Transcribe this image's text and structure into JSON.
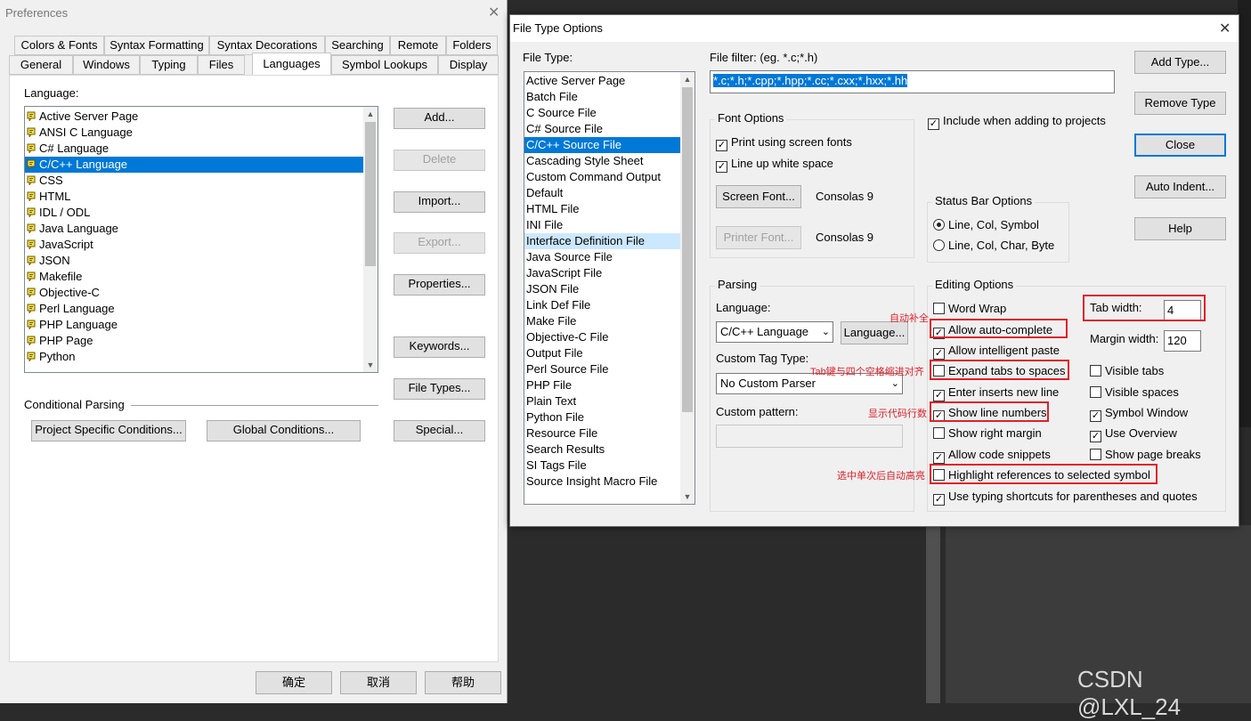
{
  "preferences": {
    "title": "Preferences",
    "tabs_row1": [
      "Colors & Fonts",
      "Syntax Formatting",
      "Syntax Decorations",
      "Searching",
      "Remote",
      "Folders"
    ],
    "tabs_row2": [
      "General",
      "Windows",
      "Typing",
      "Files",
      "Languages",
      "Symbol Lookups",
      "Display"
    ],
    "language_label": "Language:",
    "languages": [
      "Active Server Page",
      "ANSI C Language",
      "C# Language",
      "C/C++ Language",
      "CSS",
      "HTML",
      "IDL / ODL",
      "Java Language",
      "JavaScript",
      "JSON",
      "Makefile",
      "Objective-C",
      "Perl Language",
      "PHP Language",
      "PHP Page",
      "Python"
    ],
    "buttons": {
      "add": "Add...",
      "delete": "Delete",
      "import": "Import...",
      "export": "Export...",
      "properties": "Properties...",
      "keywords": "Keywords...",
      "file_types": "File Types...",
      "special": "Special..."
    },
    "conditional_label": "Conditional Parsing",
    "project_conditions": "Project Specific Conditions...",
    "global_conditions": "Global Conditions...",
    "ok": "确定",
    "cancel": "取消",
    "help": "帮助"
  },
  "file_type_options": {
    "title": "File Type Options",
    "file_type_label": "File Type:",
    "file_types": [
      "Active Server Page",
      "Batch File",
      "C Source File",
      "C# Source File",
      "C/C++ Source File",
      "Cascading Style Sheet",
      "Custom Command Output",
      "Default",
      "HTML File",
      "INI File",
      "Interface Definition File",
      "Java Source File",
      "JavaScript File",
      "JSON File",
      "Link Def File",
      "Make File",
      "Objective-C File",
      "Output File",
      "Perl Source File",
      "PHP File",
      "Plain Text",
      "Python File",
      "Resource File",
      "Search Results",
      "SI Tags File",
      "Source Insight Macro File"
    ],
    "file_filter_label": "File filter: (eg. *.c;*.h)",
    "file_filter_value": "*.c;*.h;*.cpp;*.hpp;*.cc;*.cxx;*.hxx;*.hh",
    "font_options": {
      "label": "Font Options",
      "print_screen_fonts": "Print using screen fonts",
      "line_up_white_space": "Line up white space",
      "screen_font_btn": "Screen Font...",
      "screen_font_value": "Consolas 9",
      "printer_font_btn": "Printer Font...",
      "printer_font_value": "Consolas 9"
    },
    "include_projects": "Include when adding to projects",
    "status_bar": {
      "label": "Status Bar Options",
      "opt1": "Line, Col, Symbol",
      "opt2": "Line, Col, Char, Byte"
    },
    "parsing": {
      "label": "Parsing",
      "language_label": "Language:",
      "language_value": "C/C++ Language",
      "language_btn": "Language...",
      "custom_tag_label": "Custom Tag Type:",
      "custom_tag_value": "No Custom Parser",
      "custom_pattern_label": "Custom pattern:"
    },
    "editing": {
      "label": "Editing Options",
      "word_wrap": "Word Wrap",
      "auto_complete": "Allow auto-complete",
      "intelligent_paste": "Allow intelligent paste",
      "expand_tabs": "Expand tabs to spaces",
      "enter_new_line": "Enter inserts new line",
      "line_numbers": "Show line numbers",
      "right_margin": "Show right margin",
      "code_snippets": "Allow code snippets",
      "highlight_refs": "Highlight references to selected symbol",
      "typing_shortcuts": "Use typing shortcuts for parentheses and quotes",
      "tab_width_label": "Tab width:",
      "tab_width_value": "4",
      "margin_width_label": "Margin width:",
      "margin_width_value": "120",
      "visible_tabs": "Visible tabs",
      "visible_spaces": "Visible spaces",
      "symbol_window": "Symbol Window",
      "use_overview": "Use Overview",
      "page_breaks": "Show page breaks"
    },
    "buttons": {
      "add_type": "Add Type...",
      "remove_type": "Remove Type",
      "close": "Close",
      "auto_indent": "Auto Indent...",
      "help": "Help"
    }
  },
  "annotations": {
    "auto_complete": "自动补全",
    "expand_tabs": "Tab键与四个空格缩进对齐",
    "line_numbers": "显示代码行数",
    "highlight": "选中单次后自动高亮"
  },
  "watermark": "CSDN @LXL_24",
  "colors": {
    "accent": "#0078d7",
    "annotation": "#e0202a",
    "selection_light": "#cce8ff"
  }
}
